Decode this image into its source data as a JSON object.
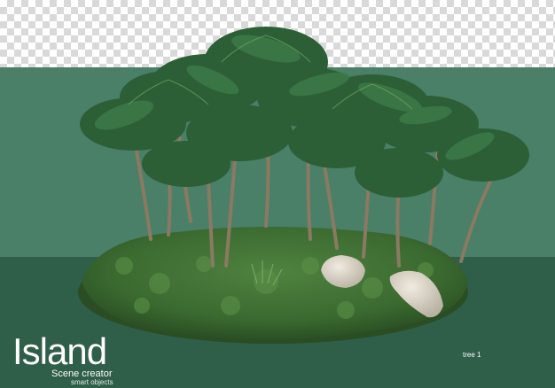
{
  "poster": {
    "title": "Island",
    "subtitle": "Scene creator",
    "tagline": "smart objects",
    "object_label": "tree 1"
  },
  "colors": {
    "checker_light": "#ffffff",
    "checker_dark": "#d9d9d9",
    "background_mid": "#4a7f68",
    "background_low": "#2f5e49",
    "grass": "#3f6e33",
    "palm_leaf": "#2f6a3c",
    "palm_trunk": "#8a7a62",
    "rock": "#d8d2c4",
    "text": "#ffffff"
  },
  "scene": {
    "subject": "floating tropical island",
    "elements": [
      "palm-tree-grove",
      "grass-mound",
      "rock",
      "rock"
    ]
  }
}
